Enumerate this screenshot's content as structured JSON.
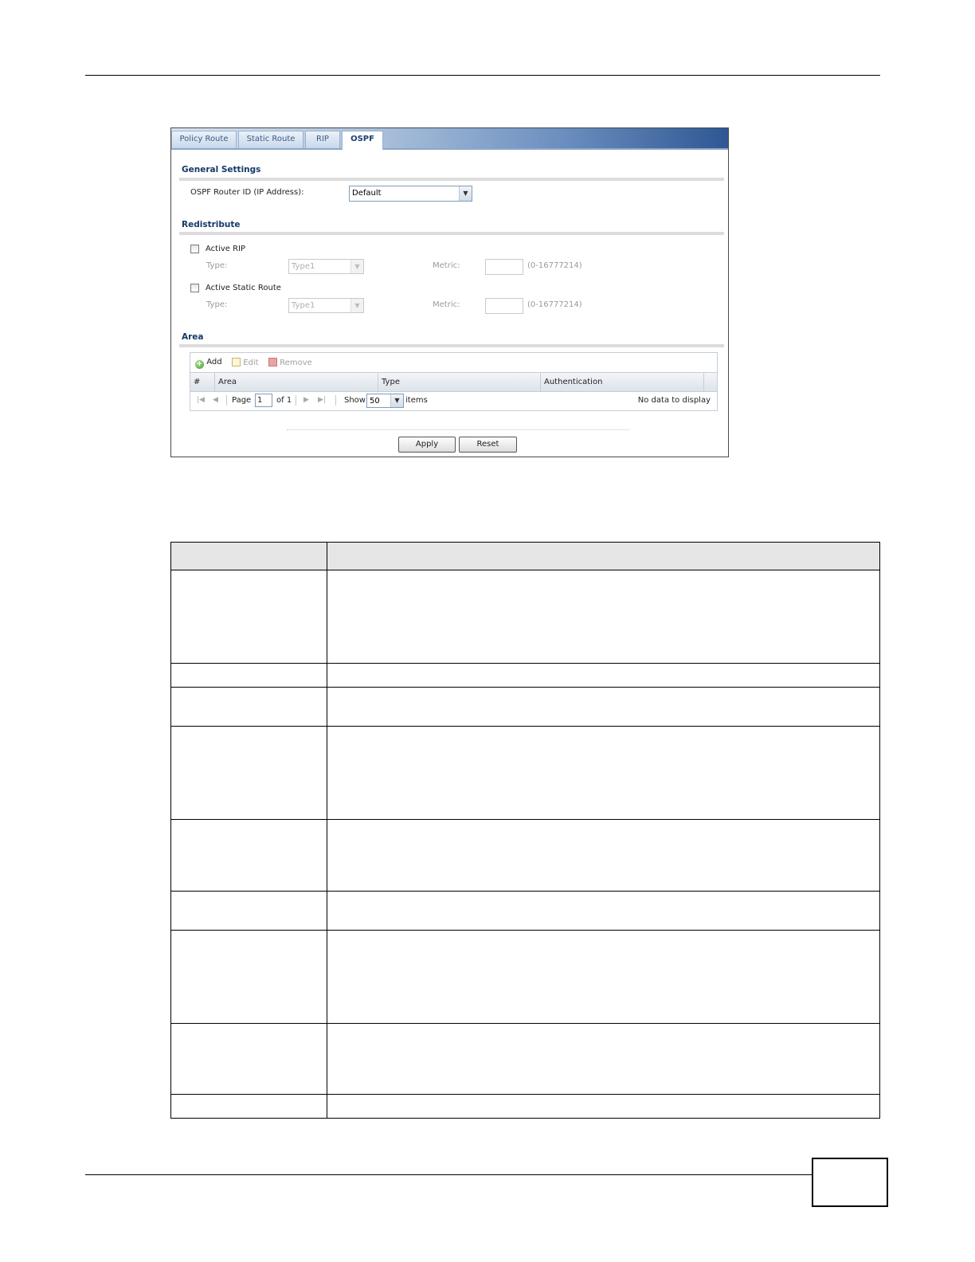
{
  "tabs": [
    {
      "label": "Policy Route"
    },
    {
      "label": "Static Route"
    },
    {
      "label": "RIP"
    },
    {
      "label": "OSPF"
    }
  ],
  "general_settings": {
    "title": "General Settings",
    "router_id_label": "OSPF Router ID (IP Address):",
    "router_id_value": "Default"
  },
  "redistribute": {
    "title": "Redistribute",
    "active_rip": {
      "label": "Active RIP",
      "type_label": "Type:",
      "type_value": "Type1",
      "metric_label": "Metric:",
      "metric_range": "(0-16777214)",
      "checked": false
    },
    "active_static": {
      "label": "Active Static Route",
      "type_label": "Type:",
      "type_value": "Type1",
      "metric_label": "Metric:",
      "metric_range": "(0-16777214)",
      "checked": false
    }
  },
  "area": {
    "title": "Area",
    "toolbar": {
      "add": "Add",
      "edit": "Edit",
      "remove": "Remove"
    },
    "columns": [
      "#",
      "Area",
      "Type",
      "Authentication"
    ],
    "pager": {
      "page_label": "Page",
      "page_value": "1",
      "of_label": "of 1",
      "show_label": "Show",
      "show_value": "50",
      "items_label": "items",
      "empty_text": "No data to display"
    }
  },
  "buttons": {
    "apply": "Apply",
    "reset": "Reset"
  }
}
